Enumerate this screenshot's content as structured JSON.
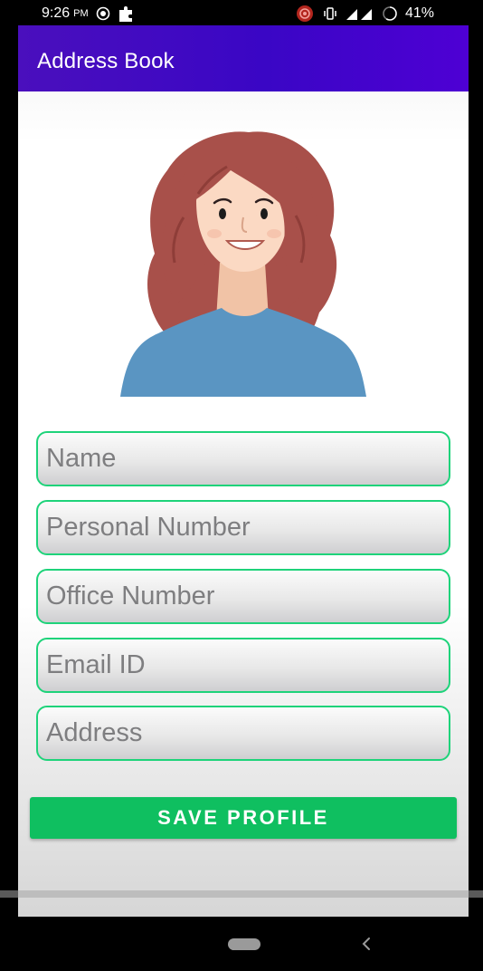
{
  "status_bar": {
    "time": "9:26",
    "ampm": "PM",
    "battery": "41%"
  },
  "app_bar": {
    "title": "Address Book"
  },
  "form": {
    "name_placeholder": "Name",
    "personal_number_placeholder": "Personal Number",
    "office_number_placeholder": "Office Number",
    "email_placeholder": "Email ID",
    "address_placeholder": "Address"
  },
  "save_label": "SAVE PROFILE",
  "colors": {
    "app_bar": "#3a06c5",
    "field_border": "#1ed37a",
    "button": "#0fbf60",
    "hair": "#a8504a",
    "shirt": "#5a95c2",
    "skin": "#fbd9c3"
  },
  "icons": [
    "screen-record-icon",
    "puzzle-icon",
    "record-icon",
    "vibrate-icon",
    "signal-icon",
    "battery-icon",
    "home-pill-icon",
    "back-icon"
  ]
}
